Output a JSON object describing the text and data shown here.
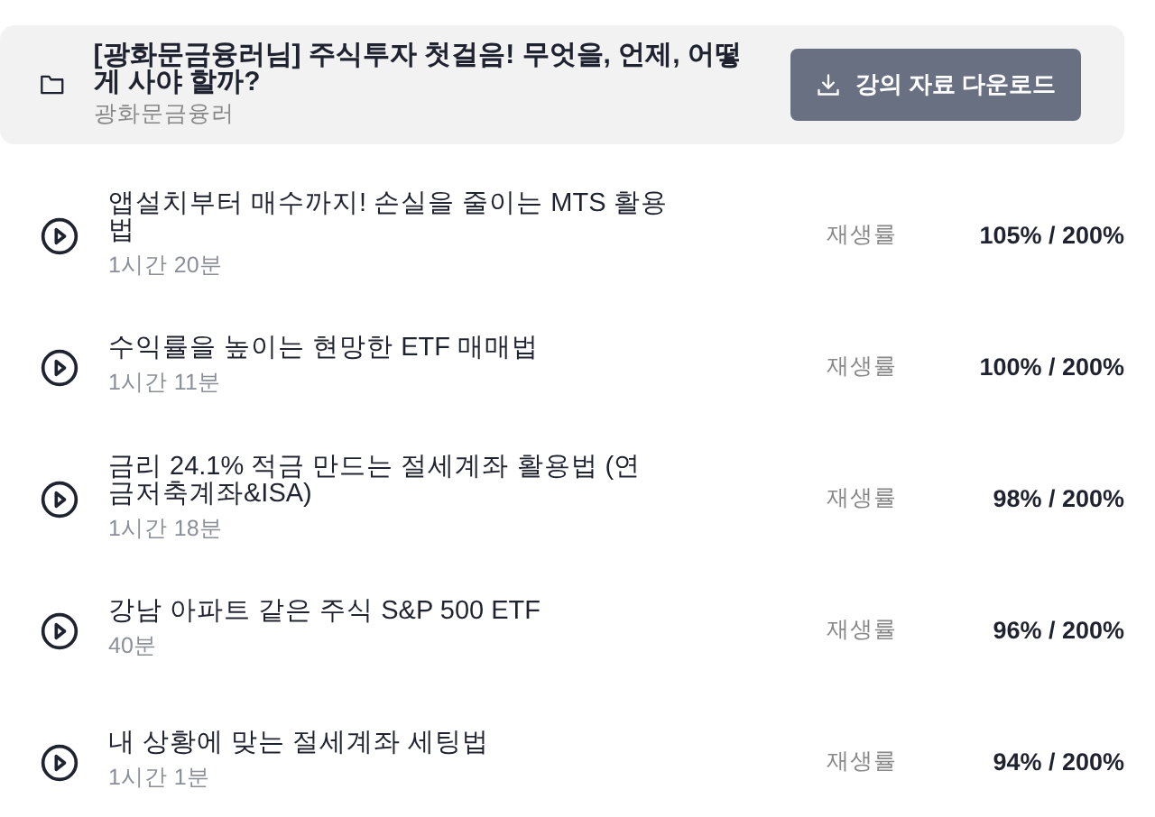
{
  "header": {
    "title": "[광화문금융러님] 주식투자 첫걸음! 무엇을, 언제, 어떻게 사야 할까?",
    "subtitle": "광화문금융러",
    "download_button": "강의 자료 다운로드"
  },
  "lessons": [
    {
      "title": "앱설치부터 매수까지! 손실을 줄이는 MTS 활용법",
      "duration": "1시간 20분",
      "progress_label": "재생률",
      "progress": "105% / 200%"
    },
    {
      "title": "수익률을 높이는 현망한 ETF 매매법",
      "duration": "1시간 11분",
      "progress_label": "재생률",
      "progress": "100% / 200%"
    },
    {
      "title": "금리 24.1% 적금 만드는 절세계좌 활용법 (연금저축계좌&ISA)",
      "duration": "1시간 18분",
      "progress_label": "재생률",
      "progress": "98% / 200%"
    },
    {
      "title": "강남 아파트 같은 주식 S&P 500 ETF",
      "duration": "40분",
      "progress_label": "재생률",
      "progress": "96% / 200%"
    },
    {
      "title": "내 상황에 맞는 절세계좌 세팅법",
      "duration": "1시간 1분",
      "progress_label": "재생률",
      "progress": "94% / 200%"
    }
  ]
}
